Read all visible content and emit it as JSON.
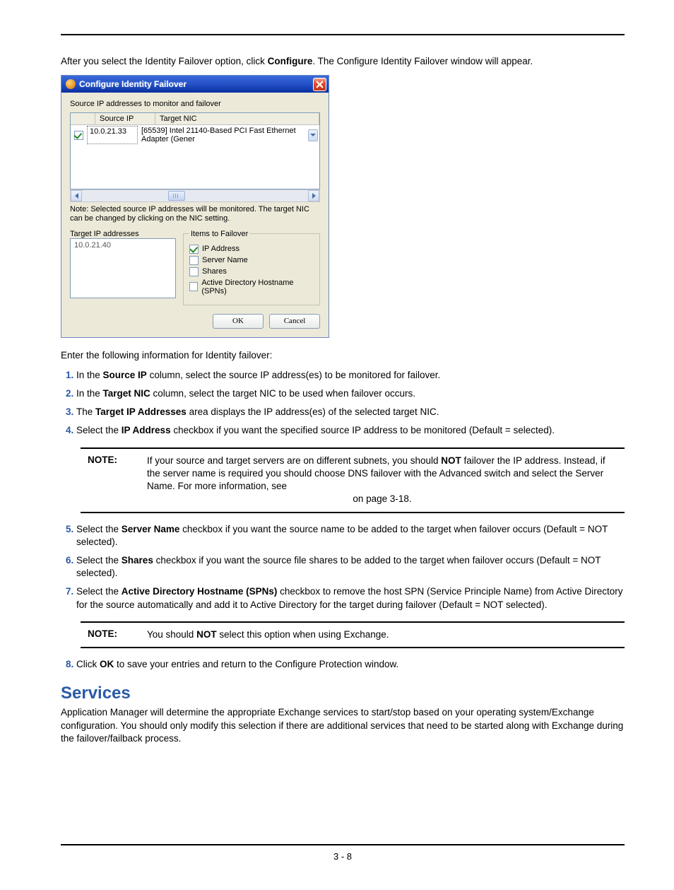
{
  "intro1_a": "After you select the Identity Failover option, click ",
  "intro1_bold": "Configure",
  "intro1_b": ". The Configure Identity Failover window will appear.",
  "dialog": {
    "title": "Configure Identity Failover",
    "source_monitor_label": "Source IP addresses to monitor and failover",
    "col_source_ip": "Source IP",
    "col_target_nic": "Target NIC",
    "row_ip": "10.0.21.33",
    "row_nic": "[65539] Intel 21140-Based PCI Fast Ethernet Adapter (Gener",
    "note_text": "Note:  Selected source IP addresses will be monitored.  The target NIC can be changed by clicking on the NIC setting.",
    "target_label": "Target IP addresses",
    "target_value": "10.0.21.40",
    "items_legend": "Items to Failover",
    "chk_ip": "IP Address",
    "chk_server": "Server Name",
    "chk_shares": "Shares",
    "chk_ad": "Active Directory Hostname (SPNs)",
    "ok": "OK",
    "cancel": "Cancel"
  },
  "intro2": "Enter the following information for Identity failover:",
  "step1_a": "In the ",
  "step1_bold": "Source IP",
  "step1_b": " column, select the source IP address(es) to be monitored for failover.",
  "step2_a": "In the ",
  "step2_bold": "Target NIC",
  "step2_b": " column, select the target NIC to be used when failover occurs.",
  "step3_a": "The ",
  "step3_bold": "Target IP Addresses",
  "step3_b": " area displays the IP address(es) of the selected target NIC.",
  "step4_a": "Select the ",
  "step4_bold": "IP Address",
  "step4_b": " checkbox if you want the specified source IP address to be monitored (Default = selected).",
  "note1": {
    "label": "NOTE:",
    "body_a": "If your source and target servers are on different subnets, you should ",
    "body_not": "NOT",
    "body_b": " failover the IP address. Instead, if the server name is required you should choose DNS failover with the Advanced switch and select the Server Name. For more information, see",
    "body_c": "on page 3-18."
  },
  "step5_a": "Select the ",
  "step5_bold": "Server Name",
  "step5_b": " checkbox if you want the source name to be added to the target when failover occurs (Default = NOT selected).",
  "step6_a": "Select the ",
  "step6_bold": "Shares",
  "step6_b": " checkbox if you want the source file shares to be added to the target when failover occurs (Default = NOT selected).",
  "step7_a": "Select the ",
  "step7_bold": "Active Directory Hostname (SPNs)",
  "step7_b": " checkbox to remove the host SPN (Service Principle Name) from Active Directory for the source automatically and add it to Active Directory for the target during failover (Default = NOT selected).",
  "note2": {
    "label": "NOTE:",
    "body_a": "You should ",
    "body_not": "NOT",
    "body_b": " select this option when using Exchange."
  },
  "step8_a": "Click ",
  "step8_bold": "OK",
  "step8_b": " to save your entries and return to the Configure Protection window.",
  "services_heading": "Services",
  "services_para": "Application Manager will determine the appropriate Exchange services to start/stop based on your operating system/Exchange configuration. You should only modify this selection if there are additional services that need to be started along with Exchange during the failover/failback process.",
  "page_num": "3 - 8"
}
